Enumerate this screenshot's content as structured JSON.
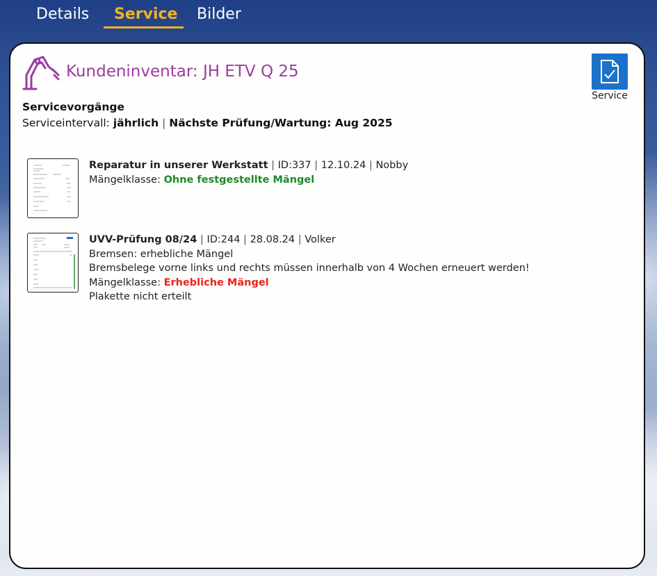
{
  "tabs": {
    "details": "Details",
    "service": "Service",
    "bilder": "Bilder"
  },
  "header": {
    "title": "Kundeninventar: JH ETV Q 25",
    "icon": "forklift-arm-icon",
    "service_button_label": "Service"
  },
  "section": {
    "title": "Servicevorgänge",
    "interval_label": "Serviceintervall: ",
    "interval_value": "jährlich",
    "next_check": "Nächste Prüfung/Wartung: Aug 2025"
  },
  "records": [
    {
      "title": "Reparatur in unserer Werkstatt",
      "id": "ID:337",
      "date": "12.10.24",
      "user": "Nobby",
      "lines": [],
      "class_label": "Mängelklasse: ",
      "class_value": "Ohne festgestellte Mängel",
      "after_lines": []
    },
    {
      "title": "UVV-Prüfung 08/24",
      "id": "ID:244",
      "date": "28.08.24",
      "user": "Volker",
      "lines": [
        "Bremsen: erhebliche Mängel",
        "Bremsbelege vorne links und rechts müssen innerhalb von 4 Wochen erneuert werden!"
      ],
      "class_label": "Mängelklasse: ",
      "class_value": "Erhebliche Mängel",
      "after_lines": [
        "Plakette nicht erteilt"
      ]
    }
  ],
  "colors": {
    "accent": "#f3b21f",
    "title": "#9b3ca3",
    "button": "#1a72c9",
    "ok": "#1d8a2b",
    "bad": "#e8241a"
  }
}
